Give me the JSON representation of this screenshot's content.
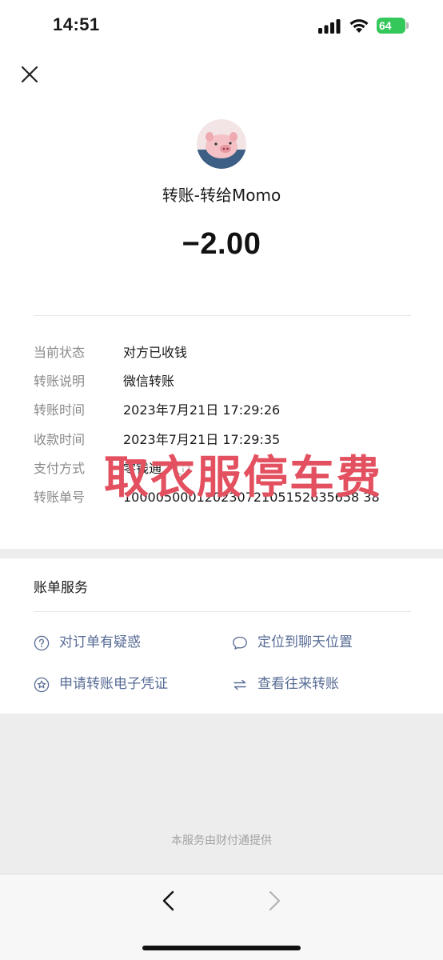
{
  "status_bar": {
    "time": "14:51",
    "battery": "64"
  },
  "header": {
    "close_icon": "close-icon"
  },
  "transaction": {
    "title": "转账-转给Momo",
    "amount": "−2.00"
  },
  "details": {
    "rows": [
      {
        "label": "当前状态",
        "value": "对方已收钱"
      },
      {
        "label": "转账说明",
        "value": "微信转账"
      },
      {
        "label": "转账时间",
        "value": "2023年7月21日 17:29:26"
      },
      {
        "label": "收款时间",
        "value": "2023年7月21日 17:29:35"
      },
      {
        "label": "支付方式",
        "value": "零钱通"
      },
      {
        "label": "转账单号",
        "value": "10000500012023072105152635658 38"
      }
    ]
  },
  "overlay_text": "取衣服停车费",
  "services": {
    "title": "账单服务",
    "items": [
      {
        "label": "对订单有疑惑",
        "icon": "question-circle-icon"
      },
      {
        "label": "定位到聊天位置",
        "icon": "chat-bubble-icon"
      },
      {
        "label": "申请转账电子凭证",
        "icon": "star-badge-icon"
      },
      {
        "label": "查看往来转账",
        "icon": "transfer-arrows-icon"
      }
    ]
  },
  "footer_note": "本服务由财付通提供",
  "colors": {
    "link": "#576b95",
    "overlay": "#e3505f",
    "battery": "#34c759"
  }
}
